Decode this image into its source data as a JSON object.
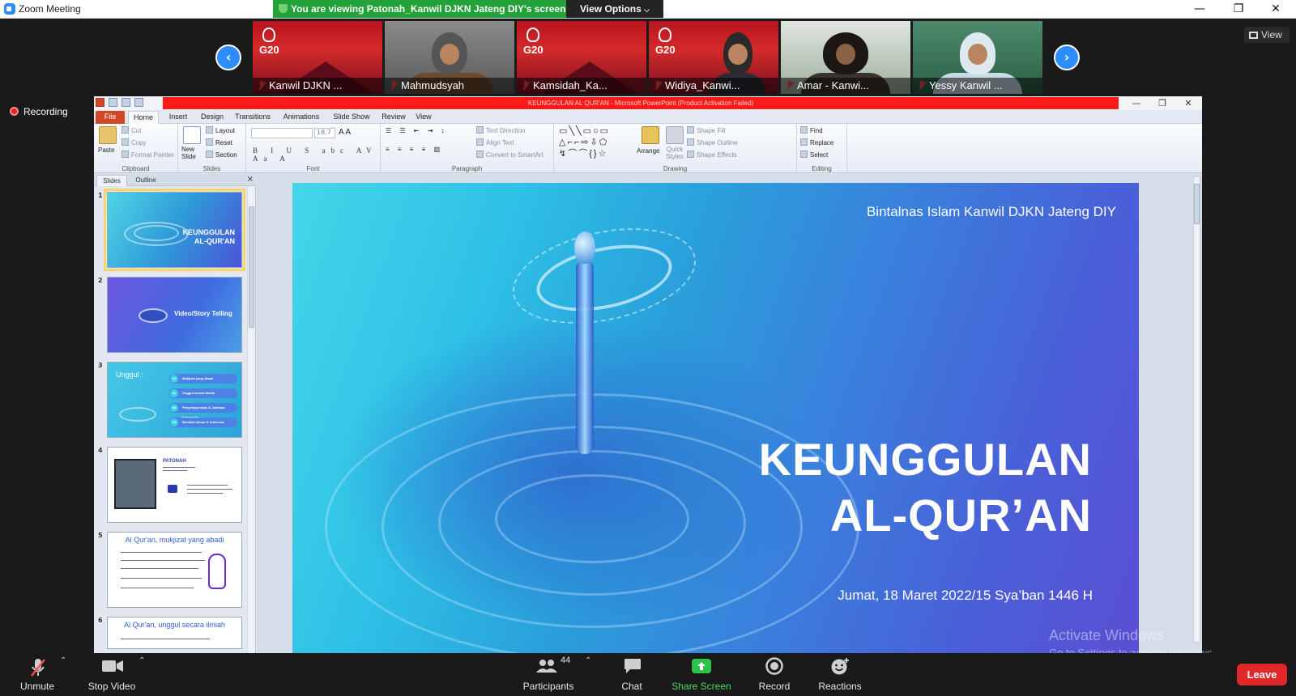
{
  "window": {
    "title": "Zoom Meeting",
    "viewing_banner": "You are viewing Patonah_Kanwil DJKN Jateng DIY's screen",
    "view_options_label": "View Options",
    "minimize_glyph": "—",
    "restore_glyph": "❐",
    "close_glyph": "✕"
  },
  "gallery": {
    "prev_glyph": "‹",
    "next_glyph": "›",
    "view_label": "View",
    "participants": [
      {
        "name": "Kanwil DJKN ...",
        "tile": "g20",
        "muted": true
      },
      {
        "name": "Mahmudsyah",
        "tile": "photo",
        "muted": true
      },
      {
        "name": "Kamsidah_Ka...",
        "tile": "g20",
        "muted": true
      },
      {
        "name": "Widiya_Kanwi...",
        "tile": "g20-person",
        "muted": true
      },
      {
        "name": "Amar - Kanwi...",
        "tile": "photo-light",
        "muted": true
      },
      {
        "name": "Yessy Kanwil ...",
        "tile": "photo-green",
        "muted": true
      }
    ]
  },
  "recording_label": "Recording",
  "powerpoint": {
    "title_bar_text": "KEUNGGULAN AL QUR'AN  -  Microsoft PowerPoint (Product Activation Failed)",
    "tabs": [
      "File",
      "Home",
      "Insert",
      "Design",
      "Transitions",
      "Animations",
      "Slide Show",
      "Review",
      "View"
    ],
    "active_tab": "Home",
    "ribbon": {
      "clipboard": {
        "label": "Clipboard",
        "paste": "Paste",
        "cut": "Cut",
        "copy": "Copy",
        "format_painter": "Format Painter"
      },
      "slides": {
        "label": "Slides",
        "new_slide": "New Slide",
        "layout": "Layout",
        "reset": "Reset",
        "section": "Section"
      },
      "font": {
        "label": "Font",
        "size": "18.7",
        "format_buttons": "B I U S abc AV Aa A"
      },
      "paragraph": {
        "label": "Paragraph",
        "text_direction": "Text Direction",
        "align_text": "Align Text",
        "convert": "Convert to SmartArt"
      },
      "drawing": {
        "label": "Drawing",
        "arrange": "Arrange",
        "quick_styles": "Quick Styles",
        "shape_fill": "Shape Fill",
        "shape_outline": "Shape Outline",
        "shape_effects": "Shape Effects"
      },
      "editing": {
        "label": "Editing",
        "find": "Find",
        "replace": "Replace",
        "select": "Select"
      }
    },
    "pane_tabs": {
      "slides": "Slides",
      "outline": "Outline",
      "close": "×"
    },
    "thumbnails": [
      {
        "num": "1",
        "title": "KEUNGGULAN\nAL-QUR'AN",
        "style": "blue1"
      },
      {
        "num": "2",
        "title": "Video/Story Telling",
        "style": "blue2"
      },
      {
        "num": "3",
        "title": "Unggul :",
        "style": "blue3",
        "pills": [
          {
            "n": "01",
            "text": "Mukjizat yang Abadi"
          },
          {
            "n": "02",
            "text": "Unggul secara Ilmiah"
          },
          {
            "n": "03",
            "text": "Penyempurnaan & Jaminan Kemurnian"
          },
          {
            "n": "04",
            "text": "Bersifat Umum & Universal"
          }
        ]
      },
      {
        "num": "4",
        "title": "PATONAH",
        "style": "white"
      },
      {
        "num": "5",
        "title": "Al Qur'an, mukjizat yang abadi",
        "style": "white"
      },
      {
        "num": "6",
        "title": "Al Qur'an, unggul secara ilmiah",
        "style": "white"
      }
    ],
    "current_slide": {
      "org": "Bintalnas Islam Kanwil DJKN Jateng DIY",
      "title_line1": "KEUNGGULAN",
      "title_line2": "AL-QUR’AN",
      "date": "Jumat, 18 Maret 2022/15 Sya’ban 1446 H"
    }
  },
  "watermark": {
    "line1": "Activate Windows",
    "line2": "Go to Settings to activate Windows."
  },
  "toolbar": {
    "unmute": "Unmute",
    "stop_video": "Stop Video",
    "participants": "Participants",
    "participants_count": "44",
    "chat": "Chat",
    "share_screen": "Share Screen",
    "record": "Record",
    "reactions": "Reactions",
    "leave": "Leave"
  },
  "colors": {
    "zoom_blue": "#2d8cff",
    "banner_green": "#23a23a",
    "leave_red": "#e02828",
    "share_green": "#4bdb62"
  }
}
